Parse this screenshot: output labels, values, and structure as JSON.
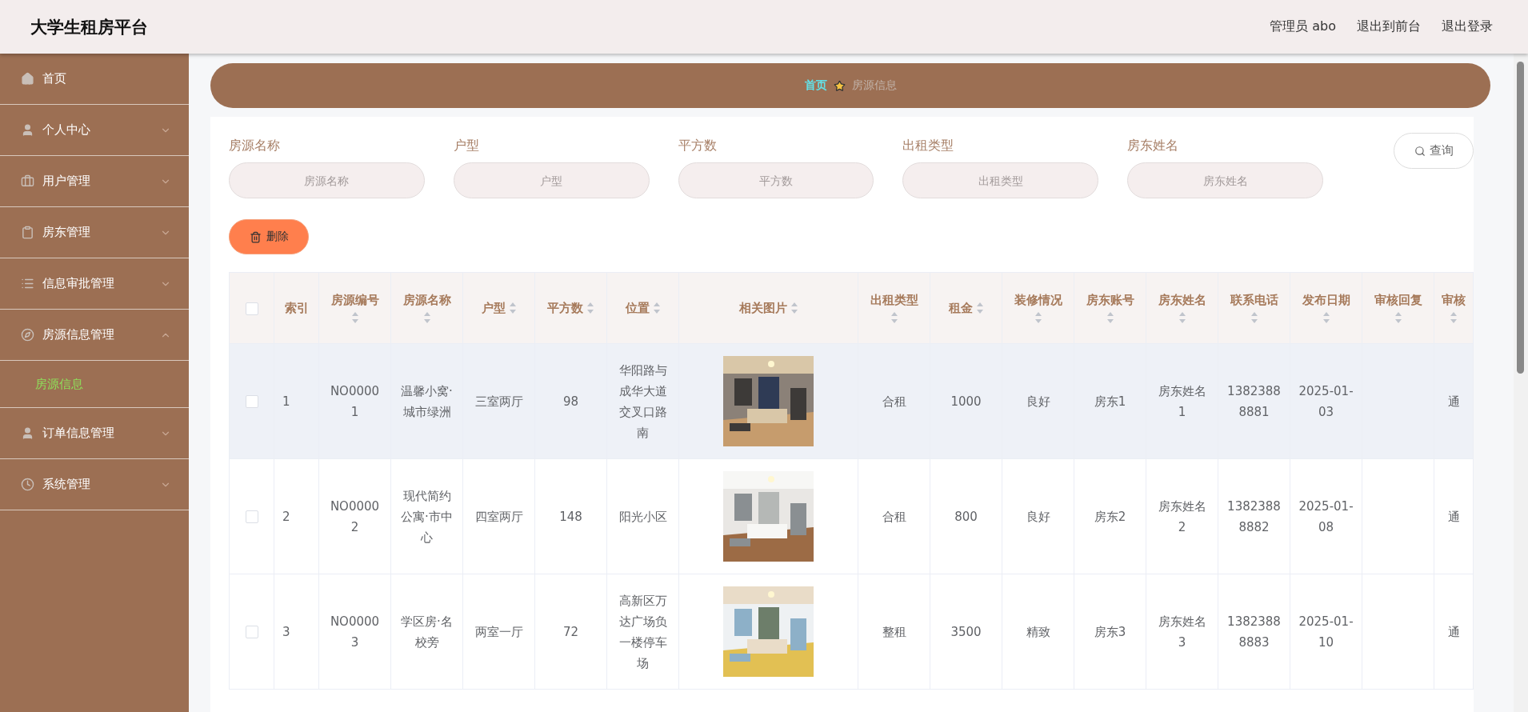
{
  "header": {
    "title": "大学生租房平台",
    "links": [
      {
        "label": "管理员 abo"
      },
      {
        "label": "退出到前台"
      },
      {
        "label": "退出登录"
      }
    ]
  },
  "sidebar": {
    "items": [
      {
        "label": "首页"
      },
      {
        "label": "个人中心",
        "expanded": false
      },
      {
        "label": "用户管理",
        "expanded": false
      },
      {
        "label": "房东管理",
        "expanded": false
      },
      {
        "label": "信息审批管理",
        "expanded": false
      },
      {
        "label": "房源信息管理",
        "expanded": true,
        "children": [
          {
            "label": "房源信息",
            "selected": true
          }
        ]
      },
      {
        "label": "订单信息管理",
        "expanded": false
      },
      {
        "label": "系统管理",
        "expanded": false
      }
    ]
  },
  "breadcrumb": [
    {
      "label": "首页"
    },
    {
      "label": "房源信息"
    }
  ],
  "search": {
    "fields": [
      {
        "label": "房源名称",
        "placeholder": "房源名称"
      },
      {
        "label": "户型",
        "placeholder": "户型"
      },
      {
        "label": "平方数",
        "placeholder": "平方数"
      },
      {
        "label": "出租类型",
        "placeholder": "出租类型"
      },
      {
        "label": "房东姓名",
        "placeholder": "房东姓名"
      }
    ],
    "button": "查询"
  },
  "actions": [
    {
      "label": "删除"
    }
  ],
  "table": {
    "header_checked": false,
    "columns": [
      {
        "kind": "checkbox"
      },
      {
        "kind": "text",
        "label": "索引",
        "sortable": false
      },
      {
        "kind": "text",
        "label": "房源编号",
        "sortable": true
      },
      {
        "kind": "text",
        "label": "房源名称",
        "sortable": true
      },
      {
        "kind": "text",
        "label": "户型",
        "sortable": true
      },
      {
        "kind": "text",
        "label": "平方数",
        "sortable": true
      },
      {
        "kind": "text",
        "label": "位置",
        "sortable": true
      },
      {
        "kind": "picture",
        "label": "相关图片",
        "sortable": true
      },
      {
        "kind": "text",
        "label": "出租类型",
        "sortable": true
      },
      {
        "kind": "text",
        "label": "租金",
        "sortable": true
      },
      {
        "kind": "text",
        "label": "装修情况",
        "sortable": true
      },
      {
        "kind": "text",
        "label": "房东账号",
        "sortable": true
      },
      {
        "kind": "text",
        "label": "房东姓名",
        "sortable": true
      },
      {
        "kind": "text",
        "label": "联系电话",
        "sortable": true
      },
      {
        "kind": "text",
        "label": "发布日期",
        "sortable": true
      },
      {
        "kind": "text",
        "label": "审核回复",
        "sortable": true
      },
      {
        "kind": "text",
        "label": "审核",
        "sortable": true
      }
    ],
    "rows": [
      {
        "highlighted": true,
        "checked": false,
        "cells": [
          "",
          "1",
          "NO00001",
          "温馨小窝·城市绿洲",
          "三室两厅",
          "98",
          "华阳路与成华大道交叉口路南",
          "",
          "合租",
          "1000",
          "良好",
          "房东1",
          "房东姓名1",
          "13823888881",
          "2025-01-03",
          "",
          "通"
        ]
      },
      {
        "highlighted": false,
        "checked": false,
        "cells": [
          "",
          "2",
          "NO00002",
          "现代简约公寓·市中心",
          "四室两厅",
          "148",
          "阳光小区",
          "",
          "合租",
          "800",
          "良好",
          "房东2",
          "房东姓名2",
          "13823888882",
          "2025-01-08",
          "",
          "通"
        ]
      },
      {
        "highlighted": false,
        "checked": false,
        "cells": [
          "",
          "3",
          "NO00003",
          "学区房·名校旁",
          "两室一厅",
          "72",
          "高新区万达广场负一楼停车场",
          "",
          "整租",
          "3500",
          "精致",
          "房东3",
          "房东姓名3",
          "13823888883",
          "2025-01-10",
          "",
          "通"
        ]
      }
    ]
  }
}
